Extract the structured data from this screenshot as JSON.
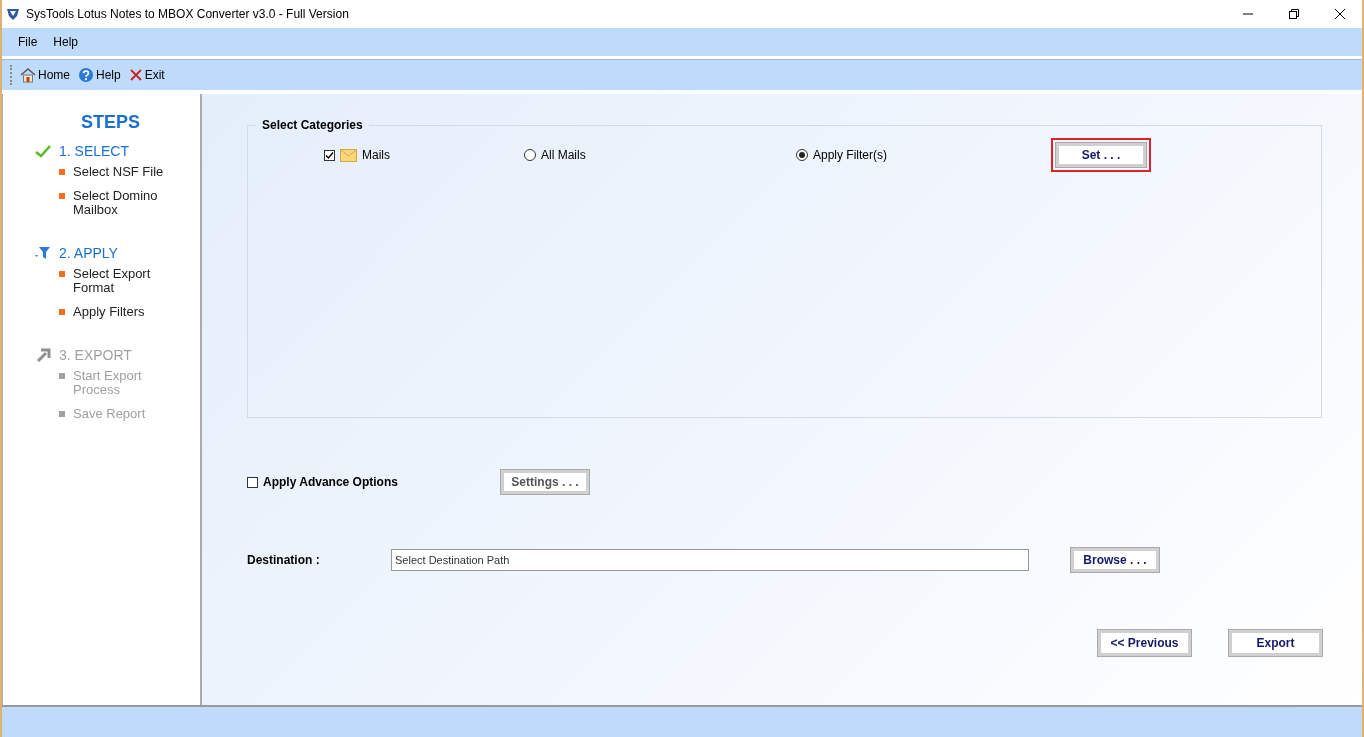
{
  "window": {
    "title": "SysTools Lotus Notes to MBOX Converter v3.0 - Full Version"
  },
  "menu": [
    "File",
    "Help"
  ],
  "toolbar": [
    {
      "kind": "home",
      "label": "Home"
    },
    {
      "kind": "help",
      "label": "Help"
    },
    {
      "kind": "exit",
      "label": "Exit"
    }
  ],
  "sidebar": {
    "title": "STEPS",
    "steps": [
      {
        "label": "1. SELECT",
        "kind": "done",
        "items": [
          "Select NSF File",
          "Select Domino Mailbox"
        ]
      },
      {
        "label": "2. APPLY",
        "kind": "active",
        "items": [
          "Select Export Format",
          "Apply Filters"
        ]
      },
      {
        "label": "3. EXPORT",
        "kind": "pending",
        "items": [
          "Start Export Process",
          "Save Report"
        ]
      }
    ]
  },
  "categories": {
    "title": "Select Categories",
    "mails": {
      "label": "Mails",
      "checked": true
    },
    "options": [
      {
        "label": "All Mails",
        "selected": false
      },
      {
        "label": "Apply Filter(s)",
        "selected": true
      }
    ],
    "set_button": {
      "label": "Set . . .",
      "highlighted": true
    }
  },
  "advance": {
    "label": "Apply Advance Options",
    "checked": false,
    "button": {
      "label": "Settings . . .",
      "disabled": true
    }
  },
  "destination": {
    "label": "Destination :",
    "placeholder": "Select Destination Path",
    "button": "Browse . . ."
  },
  "footer_buttons": [
    "<< Previous",
    "Export"
  ]
}
